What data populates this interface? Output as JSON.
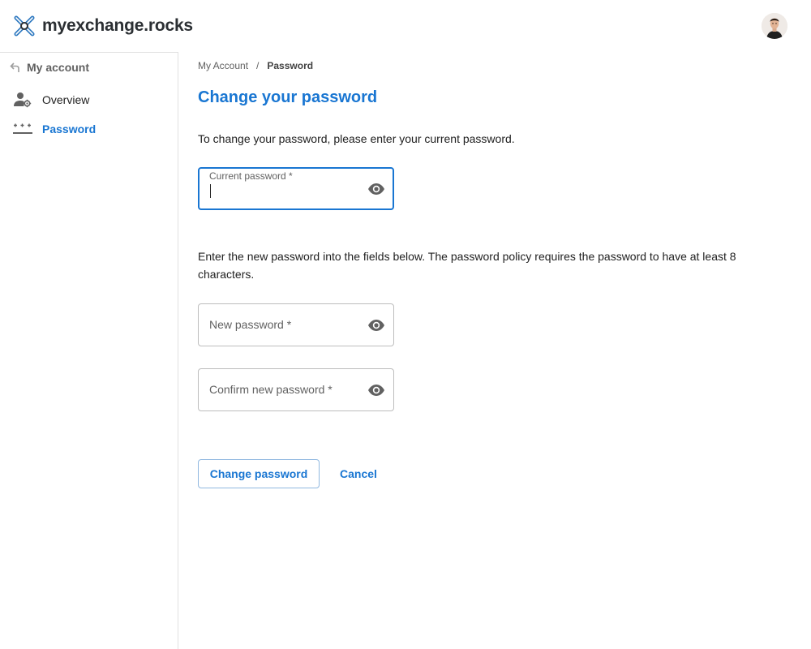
{
  "app": {
    "logo_text": "myexchange.rocks",
    "brand_color": "#1976d2"
  },
  "sidebar": {
    "back_label": "My account",
    "items": [
      {
        "label": "Overview",
        "icon": "user-gear-icon",
        "active": false
      },
      {
        "label": "Password",
        "icon": "password-dots-icon",
        "active": true
      }
    ]
  },
  "breadcrumb": {
    "parent": "My Account",
    "separator": "/",
    "current": "Password"
  },
  "main": {
    "title": "Change your password",
    "intro": "To change your password, please enter your current password.",
    "policy": "Enter the new password into the fields below. The password policy requires the password to have at least 8 characters.",
    "fields": {
      "current": {
        "label": "Current password *",
        "value": ""
      },
      "new": {
        "label": "New password *",
        "value": ""
      },
      "confirm": {
        "label": "Confirm new password *",
        "value": ""
      }
    },
    "actions": {
      "submit": "Change password",
      "cancel": "Cancel"
    }
  }
}
